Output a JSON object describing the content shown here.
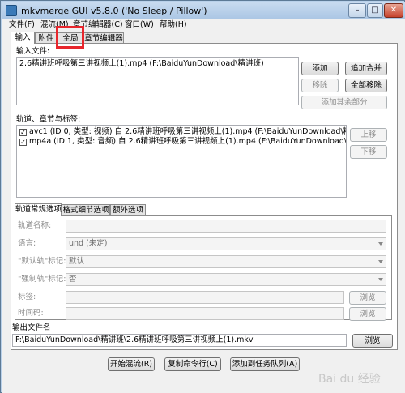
{
  "window": {
    "title": "mkvmerge GUI v5.8.0 ('No Sleep / Pillow')"
  },
  "titlebar_buttons": {
    "minimize": "–",
    "maximize": "□",
    "close": "✕"
  },
  "menu": [
    "文件(F)",
    "混流(M)",
    "章节编辑器(C)",
    "窗口(W)",
    "帮助(H)"
  ],
  "main_tabs": [
    "输入",
    "附件",
    "全局",
    "章节编辑器"
  ],
  "input_files": {
    "label": "输入文件:",
    "items": [
      "2.6精讲班呼吸第三讲视频上(1).mp4 (F:\\BaiduYunDownload\\精讲班)"
    ],
    "buttons": {
      "add": "添加",
      "append": "追加合并",
      "remove": "移除",
      "remove_all": "全部移除",
      "add_part": "添加其余部分"
    }
  },
  "tracks": {
    "label": "轨道、章节与标签:",
    "items": [
      "avc1 (ID 0, 类型: 视频) 自 2.6精讲班呼吸第三讲视频上(1).mp4 (F:\\BaiduYunDownload\\精讲班)",
      "mp4a (ID 1, 类型: 音频) 自 2.6精讲班呼吸第三讲视频上(1).mp4 (F:\\BaiduYunDownload\\精讲班)"
    ],
    "buttons": {
      "up": "上移",
      "down": "下移"
    }
  },
  "options_tabs": [
    "轨道常规选项",
    "格式细节选项",
    "额外选项"
  ],
  "options": {
    "track_name_label": "轨道名称:",
    "language_label": "语言:",
    "language_value": "und (未定)",
    "default_flag_label": "\"默认轨\"标记:",
    "default_flag_value": "默认",
    "forced_flag_label": "\"强制轨\"标记:",
    "forced_flag_value": "否",
    "tags_label": "标签:",
    "timecodes_label": "时间码:",
    "browse": "浏览"
  },
  "output": {
    "label": "输出文件名",
    "value": "F:\\BaiduYunDownload\\精讲班\\2.6精讲班呼吸第三讲视频上(1).mkv",
    "browse": "浏览"
  },
  "bottom_buttons": {
    "start": "开始混流(R)",
    "copy": "复制命令行(C)",
    "add_job": "添加到任务队列(A)"
  },
  "watermark": "Bai du 经验"
}
